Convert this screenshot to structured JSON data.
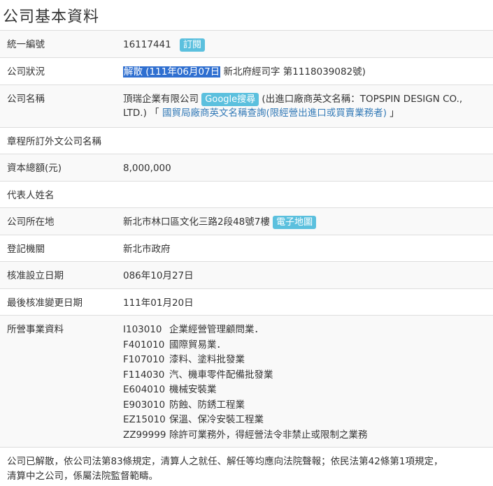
{
  "page": {
    "title": "公司基本資料"
  },
  "rows": {
    "unified_no": {
      "label": "統一編號",
      "value": "16117441",
      "subscribe_button": "訂閱"
    },
    "status": {
      "label": "公司狀況",
      "highlighted": "解散 (111年06月07日",
      "rest": " 新北府經司字 第1118039082號)"
    },
    "name": {
      "label": "公司名稱",
      "value": "頂瑞企業有限公司",
      "google_button": "Google搜尋",
      "english_name_prefix": " (出進口廠商英文名稱：TOPSPIN DESIGN CO.,",
      "english_name_cont": "LTD.) 「",
      "trade_bureau_link": " 國貿局廠商英文名稱查詢(限經營出進口或買賣業務者)",
      "english_name_suffix": " 」"
    },
    "foreign_name": {
      "label": "章程所訂外文公司名稱",
      "value": ""
    },
    "capital": {
      "label": "資本總額(元)",
      "value": "8,000,000"
    },
    "representative": {
      "label": "代表人姓名",
      "value": ""
    },
    "address": {
      "label": "公司所在地",
      "value": "新北市林口區文化三路2段48號7樓",
      "map_button": "電子地圖"
    },
    "authority": {
      "label": "登記機關",
      "value": "新北市政府"
    },
    "approval_date": {
      "label": "核准設立日期",
      "value": "086年10月27日"
    },
    "last_change_date": {
      "label": "最後核准變更日期",
      "value": "111年01月20日"
    },
    "business": {
      "label": "所營事業資料",
      "items": [
        {
          "code": "I103010",
          "desc": "企業經營管理顧問業．"
        },
        {
          "code": "F401010",
          "desc": "國際貿易業．"
        },
        {
          "code": "F107010",
          "desc": "漆料、塗料批發業"
        },
        {
          "code": "F114030",
          "desc": "汽、機車零件配備批發業"
        },
        {
          "code": "E604010",
          "desc": "機械安裝業"
        },
        {
          "code": "E903010",
          "desc": "防蝕、防銹工程業"
        },
        {
          "code": "EZ15010",
          "desc": "保溫、保冷安裝工程業"
        },
        {
          "code": "ZZ99999",
          "desc": "除許可業務外，得經營法令非禁止或限制之業務"
        }
      ]
    }
  },
  "note": {
    "line1": "公司已解散，依公司法第83條規定，清算人之就任、解任等均應向法院聲報；依民法第42條第1項規定，",
    "line2": "清算中之公司，係屬法院監督範疇。"
  },
  "colors": {
    "badge": "#5bc0de",
    "highlight": "#2f6fd0",
    "link": "#337ab7",
    "row_alt": "#f9f9f9",
    "border": "#dddddd"
  }
}
